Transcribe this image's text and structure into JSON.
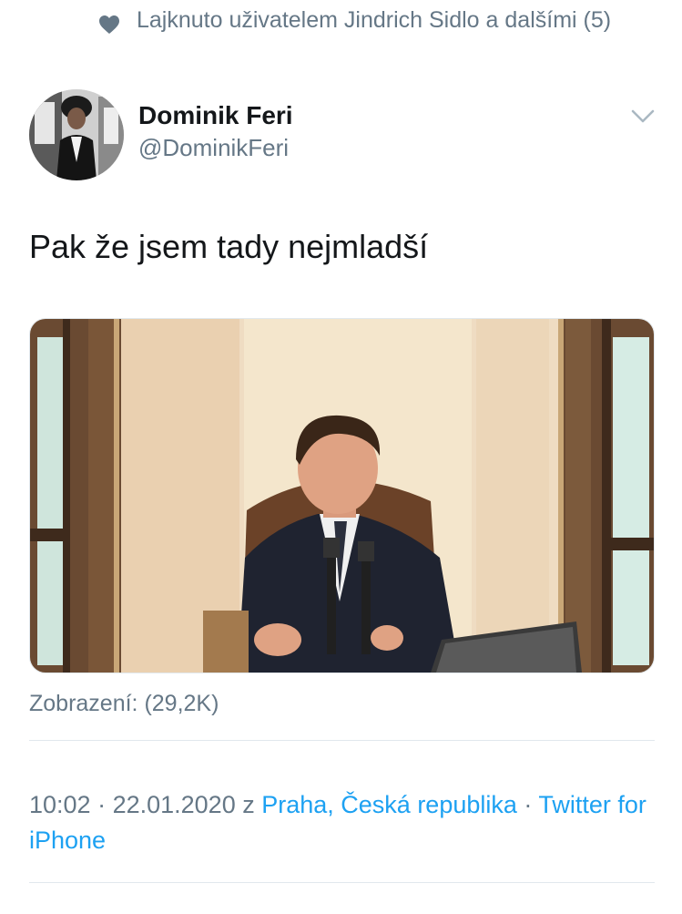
{
  "social_context": {
    "text": "Lajknuto uživatelem Jindrich Sidlo a dalšími (5)",
    "icon": "heart-icon"
  },
  "author": {
    "name": "Dominik Feri",
    "handle": "@DominikFeri"
  },
  "tweet": {
    "text": "Pak že jsem tady nejmladší"
  },
  "media": {
    "views": "Zobrazení: (29,2K)"
  },
  "meta": {
    "time": "10:02",
    "separator1": " · ",
    "date": "22.01.2020",
    "from_word": " z ",
    "location": "Praha, Česká republika",
    "separator2": " · ",
    "source": "Twitter for iPhone"
  },
  "colors": {
    "secondary_text": "#657786",
    "link": "#1da1f2",
    "divider": "#e1e8ed"
  }
}
